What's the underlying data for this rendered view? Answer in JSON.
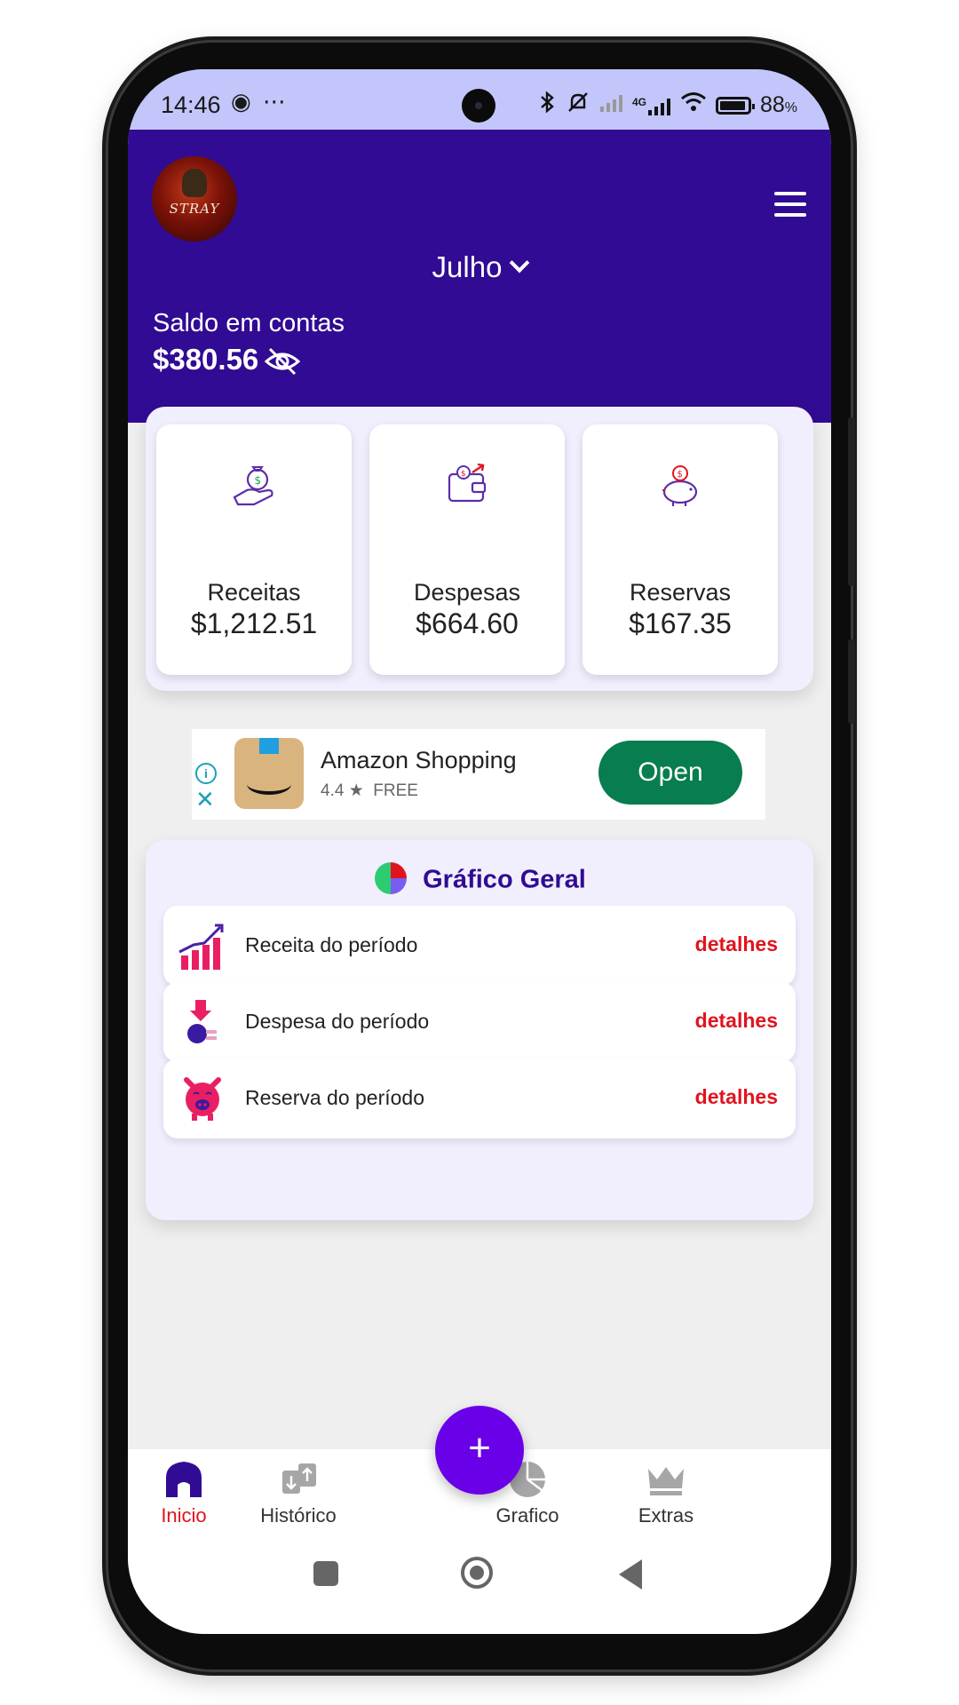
{
  "status_bar": {
    "time": "14:46",
    "left_icons": "◉ ⋯",
    "network": "4G",
    "battery": "88",
    "battery_unit": "%"
  },
  "header": {
    "avatar_text": "STRAY",
    "month": "Julho",
    "balance_label": "Saldo em contas",
    "balance_value": "$380.56"
  },
  "summary": [
    {
      "label": "Receitas",
      "value": "$1,212.51",
      "icon": "money-bag-hand-icon"
    },
    {
      "label": "Despesas",
      "value": "$664.60",
      "icon": "wallet-icon"
    },
    {
      "label": "Reservas",
      "value": "$167.35",
      "icon": "piggy-bank-icon"
    }
  ],
  "ad": {
    "info": "i",
    "close": "✕",
    "app_name": "Amazon Shopping",
    "rating": "4.4 ★",
    "price": "FREE",
    "button": "Open"
  },
  "chart_section": {
    "title": "Gráfico Geral",
    "rows": [
      {
        "label": "Receita do período",
        "link": "detalhes",
        "icon": "chart-growth-icon"
      },
      {
        "label": "Despesa do período",
        "link": "detalhes",
        "icon": "coin-down-icon"
      },
      {
        "label": "Reserva do período",
        "link": "detalhes",
        "icon": "piggy-icon"
      }
    ]
  },
  "bottom_nav": {
    "items": [
      {
        "label": "Inicio",
        "active": true
      },
      {
        "label": "Histórico"
      },
      {
        "label": "Grafico"
      },
      {
        "label": "Extras"
      }
    ],
    "fab": "+"
  },
  "colors": {
    "header": "#310b93",
    "fab": "#6a00e8",
    "link": "#e0141f",
    "active_nav": "#e0141f",
    "open_button": "#087d4f"
  }
}
